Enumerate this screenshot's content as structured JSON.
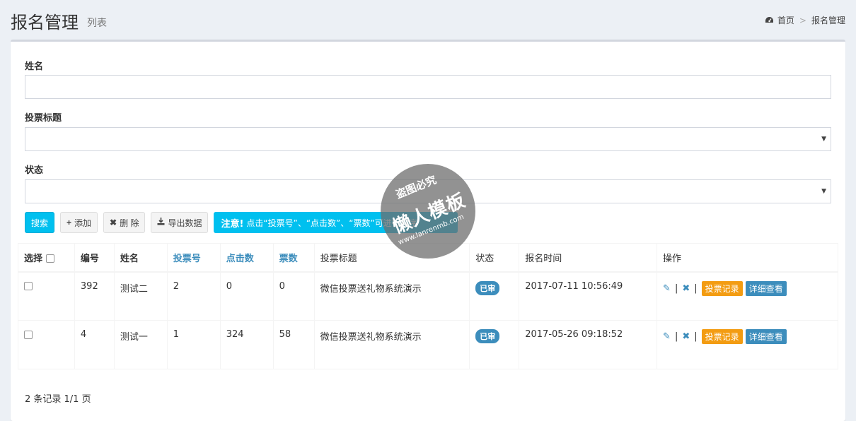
{
  "header": {
    "title": "报名管理",
    "subtitle": "列表",
    "breadcrumb": {
      "home": "首页",
      "separator": ">",
      "current": "报名管理"
    }
  },
  "form": {
    "name_label": "姓名",
    "name_value": "",
    "vote_title_label": "投票标题",
    "vote_title_value": "",
    "status_label": "状态",
    "status_value": ""
  },
  "toolbar": {
    "search": "搜索",
    "add": "添加",
    "delete": "删 除",
    "export": "导出数据",
    "note_strong": "注意!",
    "note_text": "点击“投票号”、“点击数”、“票数”可进行排序"
  },
  "table": {
    "headers": {
      "select": "选择",
      "id": "编号",
      "name": "姓名",
      "vote_no": "投票号",
      "clicks": "点击数",
      "votes": "票数",
      "vote_title": "投票标题",
      "status": "状态",
      "signup_time": "报名时间",
      "actions": "操作"
    },
    "rows": [
      {
        "id": "392",
        "name": "测试二",
        "vote_no": "2",
        "clicks": "0",
        "votes": "0",
        "vote_title": "微信投票送礼物系统演示",
        "status": "已审",
        "signup_time": "2017-07-11 10:56:49",
        "records_label": "投票记录",
        "detail_label": "详细查看"
      },
      {
        "id": "4",
        "name": "测试一",
        "vote_no": "1",
        "clicks": "324",
        "votes": "58",
        "vote_title": "微信投票送礼物系统演示",
        "status": "已审",
        "signup_time": "2017-05-26 09:18:52",
        "records_label": "投票记录",
        "detail_label": "详细查看"
      }
    ],
    "pipe": "|"
  },
  "footer": {
    "summary": "2 条记录 1/1 页"
  },
  "watermark": {
    "top": "盗图必究",
    "main": "懒人模板",
    "url": "www.lanrenmb.com"
  },
  "colors": {
    "primary": "#00c0ef",
    "link": "#3c8dbc",
    "orange": "#f39c12"
  }
}
